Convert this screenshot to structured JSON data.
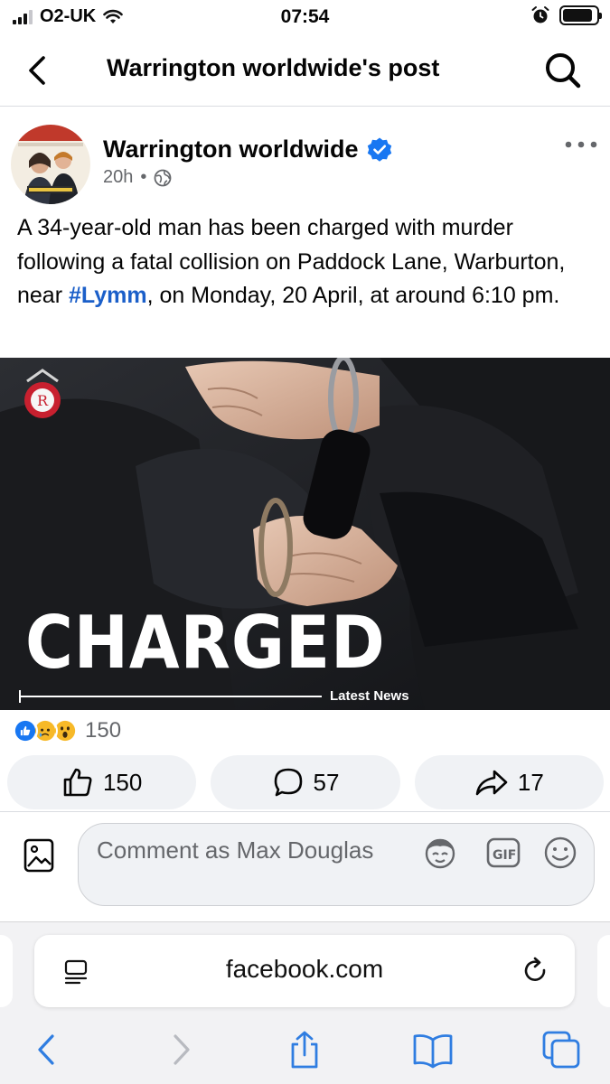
{
  "status_bar": {
    "carrier": "O2-UK",
    "time": "07:54",
    "signal_bars": 3,
    "battery_level": 0.9
  },
  "header": {
    "title": "Warrington worldwide's post"
  },
  "post": {
    "author": "Warrington worldwide",
    "time_ago": "20h",
    "separator": "•",
    "text_before": "A 34-year-old man has been charged with murder following a fatal collision on Paddock Lane, Warburton, near ",
    "hashtag": "#Lymm",
    "text_after": ", on Monday, 20 April, at around 6:10 pm.",
    "image": {
      "headline": "CHARGED",
      "caption": "Latest News"
    },
    "reactions": {
      "types": [
        "like",
        "sad",
        "wow"
      ],
      "count": "150"
    },
    "actions": {
      "like_count": "150",
      "comment_count": "57",
      "share_count": "17"
    }
  },
  "comment": {
    "placeholder": "Comment as Max Douglas"
  },
  "browser": {
    "url": "facebook.com"
  },
  "colors": {
    "accent": "#1b5fc9",
    "verified": "#1877f2",
    "secondary_text": "#65676b",
    "action_bg": "#f0f2f5",
    "safari_tint": "#2f7de1"
  }
}
